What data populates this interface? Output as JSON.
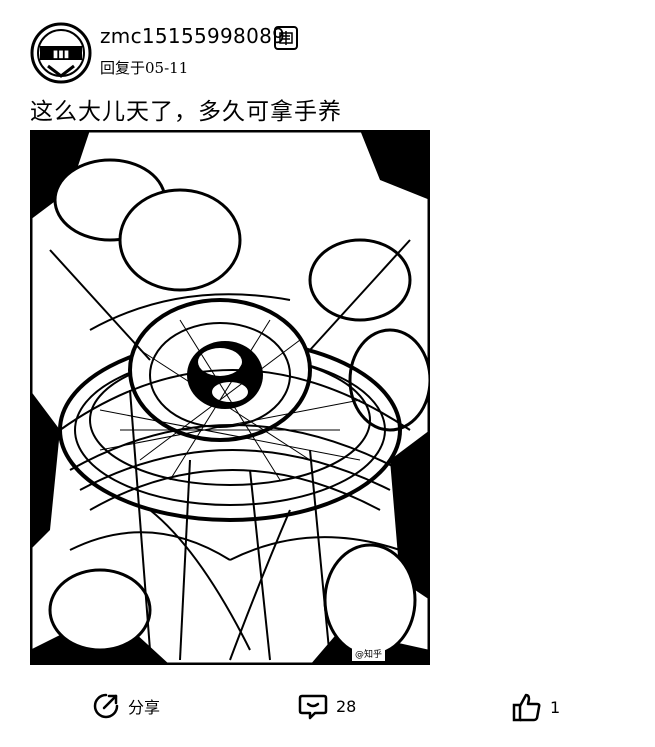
{
  "post": {
    "username": "zmc15155998089",
    "subtitle": "回复于05-11",
    "text": "这么大儿天了，多久可拿手养",
    "image_watermark": "@知乎",
    "image_icon": "bird-nest-photo"
  },
  "actions": {
    "share_label": "分享",
    "comment_count": "28",
    "like_count": "1"
  },
  "icons": {
    "avatar": "avatar-logo-icon",
    "badge": "level-badge-icon",
    "share": "share-icon",
    "comment": "comment-icon",
    "like": "thumbs-up-icon"
  }
}
